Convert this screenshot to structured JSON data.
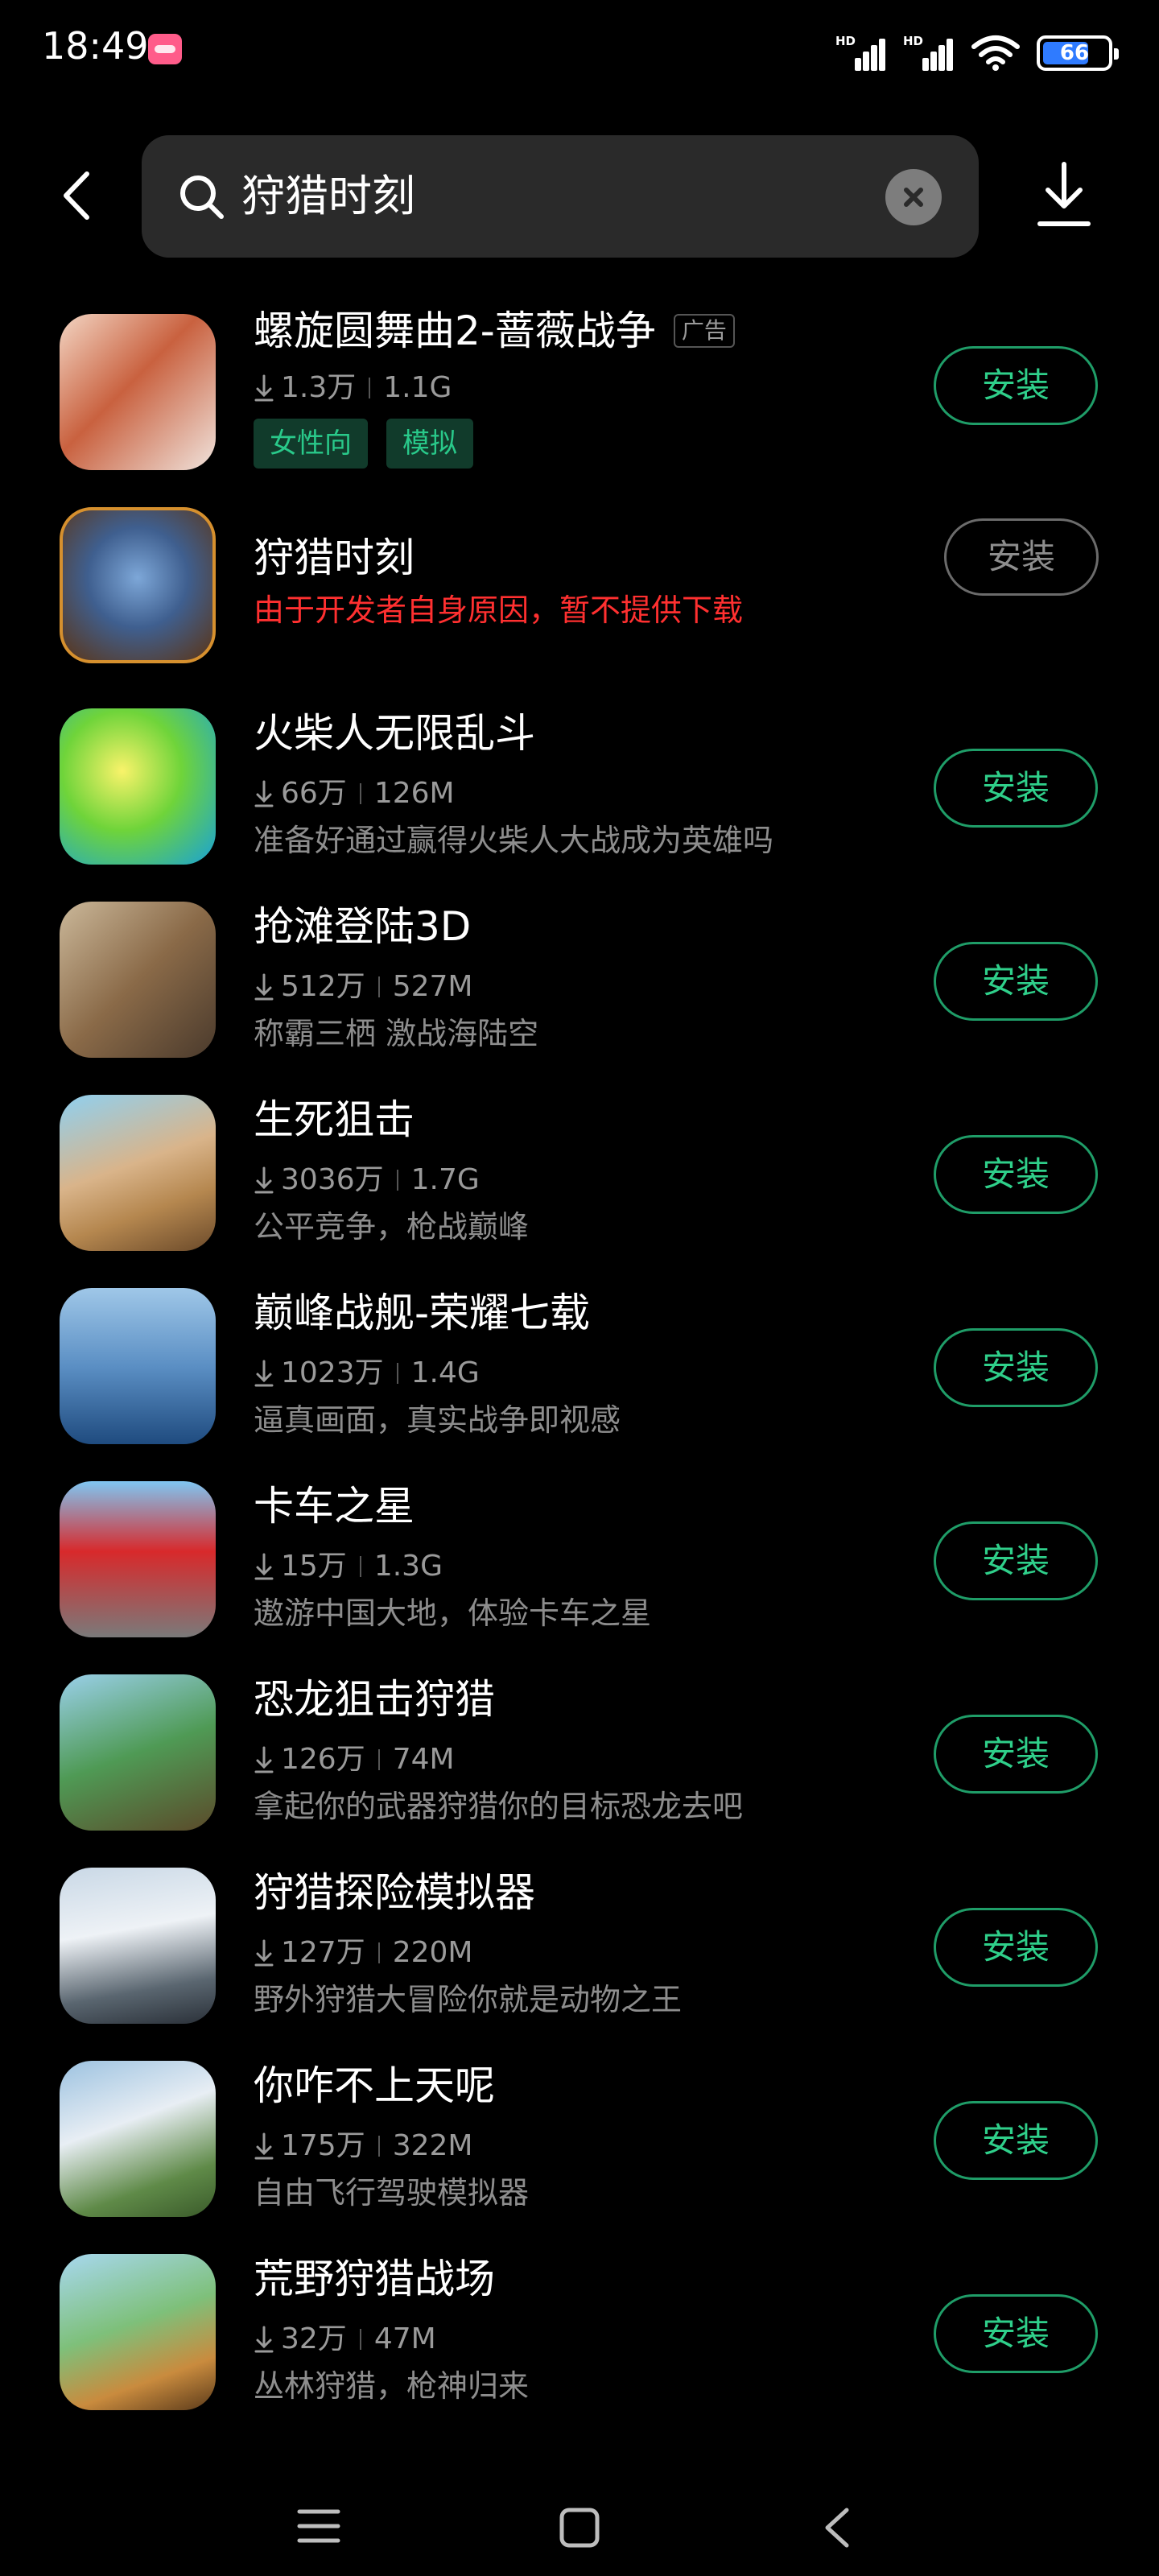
{
  "status_bar": {
    "time": "18:49",
    "network": [
      "HD",
      "HD"
    ],
    "battery": "66"
  },
  "search": {
    "query": "狩猎时刻"
  },
  "ad_label": "广告",
  "apps": [
    {
      "title": "螺旋圆舞曲2-蔷薇战争",
      "downloads": "1.3万",
      "size": "1.1G",
      "tags": [
        "女性向",
        "模拟"
      ],
      "button": "安装",
      "is_ad": true
    },
    {
      "title": "狩猎时刻",
      "notice": "由于开发者自身原因，暂不提供下载",
      "button": "安装",
      "disabled": true
    },
    {
      "title": "火柴人无限乱斗",
      "downloads": "66万",
      "size": "126M",
      "desc": "准备好通过赢得火柴人大战成为英雄吗",
      "button": "安装"
    },
    {
      "title": "抢滩登陆3D",
      "downloads": "512万",
      "size": "527M",
      "desc": "称霸三栖 激战海陆空",
      "button": "安装"
    },
    {
      "title": "生死狙击",
      "downloads": "3036万",
      "size": "1.7G",
      "desc": "公平竞争，枪战巅峰",
      "button": "安装"
    },
    {
      "title": "巅峰战舰-荣耀七载",
      "downloads": "1023万",
      "size": "1.4G",
      "desc": "逼真画面，真实战争即视感",
      "button": "安装"
    },
    {
      "title": "卡车之星",
      "downloads": "15万",
      "size": "1.3G",
      "desc": "遨游中国大地，体验卡车之星",
      "button": "安装"
    },
    {
      "title": "恐龙狙击狩猎",
      "downloads": "126万",
      "size": "74M",
      "desc": "拿起你的武器狩猎你的目标恐龙去吧",
      "button": "安装"
    },
    {
      "title": "狩猎探险模拟器",
      "downloads": "127万",
      "size": "220M",
      "desc": "野外狩猎大冒险你就是动物之王",
      "button": "安装"
    },
    {
      "title": "你咋不上天呢",
      "downloads": "175万",
      "size": "322M",
      "desc": "自由飞行驾驶模拟器",
      "button": "安装"
    },
    {
      "title": "荒野狩猎战场",
      "downloads": "32万",
      "size": "47M",
      "desc": "丛林狩猎，枪神归来",
      "button": "安装"
    }
  ],
  "colors": {
    "accent": "#2fcf8a",
    "warning": "#ff3030",
    "background": "#000000"
  }
}
